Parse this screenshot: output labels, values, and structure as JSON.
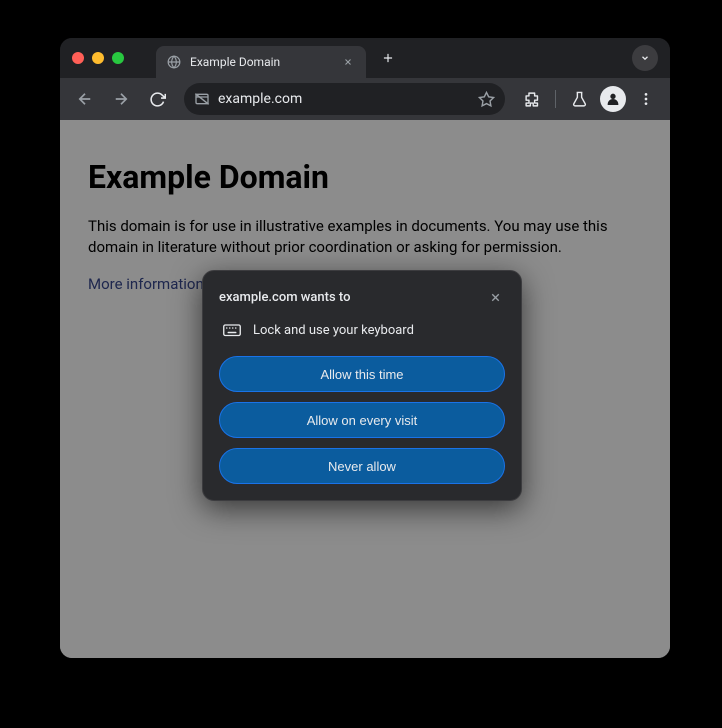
{
  "tab": {
    "title": "Example Domain"
  },
  "omnibox": {
    "url": "example.com"
  },
  "page": {
    "title": "Example Domain",
    "body": "This domain is for use in illustrative examples in documents. You may use this domain in literature without prior coordination or asking for permission.",
    "link": "More information..."
  },
  "dialog": {
    "title": "example.com wants to",
    "permission": "Lock and use your keyboard",
    "buttons": {
      "allow_once": "Allow this time",
      "allow_always": "Allow on every visit",
      "never": "Never allow"
    }
  }
}
